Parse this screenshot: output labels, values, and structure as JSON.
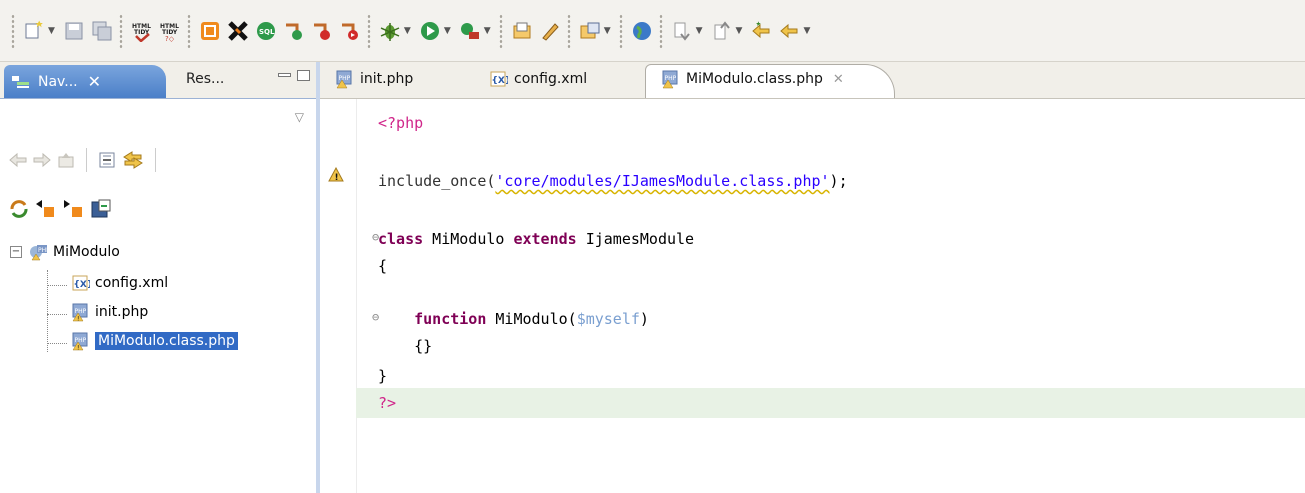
{
  "toolbar": {
    "icons": [
      "new-wizard-icon",
      "save-icon",
      "save-all-icon",
      "html-tidy-validate-icon",
      "html-tidy-format-icon",
      "build-icon",
      "stop-icon",
      "sql-icon",
      "breakpoint-icon",
      "step-icon",
      "run-to-icon",
      "debug-icon",
      "run-icon",
      "external-tools-icon",
      "open-file-icon",
      "pencil-icon",
      "open-type-icon",
      "globe-icon",
      "next-annotation-icon",
      "prev-annotation-icon",
      "last-edit-icon",
      "back-icon"
    ]
  },
  "navigator": {
    "active_tab": "Nav...",
    "inactive_tab": "Res...",
    "tree": {
      "project": "MiModulo",
      "files": [
        "config.xml",
        "init.php",
        "MiModulo.class.php"
      ],
      "selected": "MiModulo.class.php"
    }
  },
  "editor": {
    "tabs": [
      {
        "label": "init.php"
      },
      {
        "label": "config.xml"
      },
      {
        "label": "MiModulo.class.php",
        "active": true
      }
    ],
    "code": {
      "l1_open": "<?php",
      "l2_include": "include_once(",
      "l2_string": "'core/modules/IJamesModule.class.php'",
      "l2_end": ");",
      "l3_class_kw": "class",
      "l3_name": " MiModulo ",
      "l3_extends_kw": "extends",
      "l3_parent": " IjamesModule",
      "l4_brace": "{",
      "l5_function_kw": "function",
      "l5_name": " MiModulo(",
      "l5_var": "$myself",
      "l5_close": ")",
      "l6_body": "{}",
      "l7_brace": "}",
      "l8_close": "?>"
    }
  },
  "colors": {
    "keyword": "#7f0055",
    "php_tag": "#d0268a",
    "string": "#2a00ff",
    "variable": "#7a9fd0",
    "selection": "#316ac5",
    "current_line": "#e8f2e5"
  }
}
